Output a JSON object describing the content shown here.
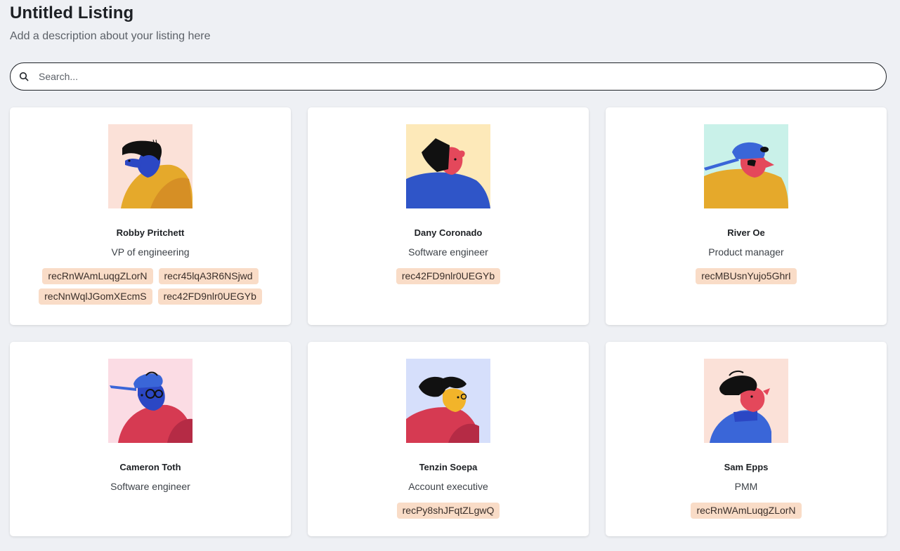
{
  "header": {
    "title": "Untitled Listing",
    "description": "Add a description about your listing here"
  },
  "search": {
    "placeholder": "Search...",
    "value": ""
  },
  "cards": [
    {
      "name": "Robby Pritchett",
      "role": "VP of engineering",
      "tags": [
        "recRnWAmLuqgZLorN",
        "recr45lqA3R6NSjwd",
        "recNnWqlJGomXEcmS",
        "rec42FD9nlr0UEGYb"
      ],
      "avatar_bg": "#fbe1d8"
    },
    {
      "name": "Dany Coronado",
      "role": "Software engineer",
      "tags": [
        "rec42FD9nlr0UEGYb"
      ],
      "avatar_bg": "#fde9b9"
    },
    {
      "name": "River Oe",
      "role": "Product manager",
      "tags": [
        "recMBUsnYujo5GhrI"
      ],
      "avatar_bg": "#c9f1e9"
    },
    {
      "name": "Cameron Toth",
      "role": "Software engineer",
      "tags": [],
      "avatar_bg": "#fbdce4"
    },
    {
      "name": "Tenzin Soepa",
      "role": "Account executive",
      "tags": [
        "recPy8shJFqtZLgwQ"
      ],
      "avatar_bg": "#d6dffb"
    },
    {
      "name": "Sam Epps",
      "role": "PMM",
      "tags": [
        "recRnWAmLuqgZLorN"
      ],
      "avatar_bg": "#fbe1d8"
    }
  ],
  "colors": {
    "tag_bg": "#f9dcc7",
    "page_bg": "#eef0f4"
  }
}
